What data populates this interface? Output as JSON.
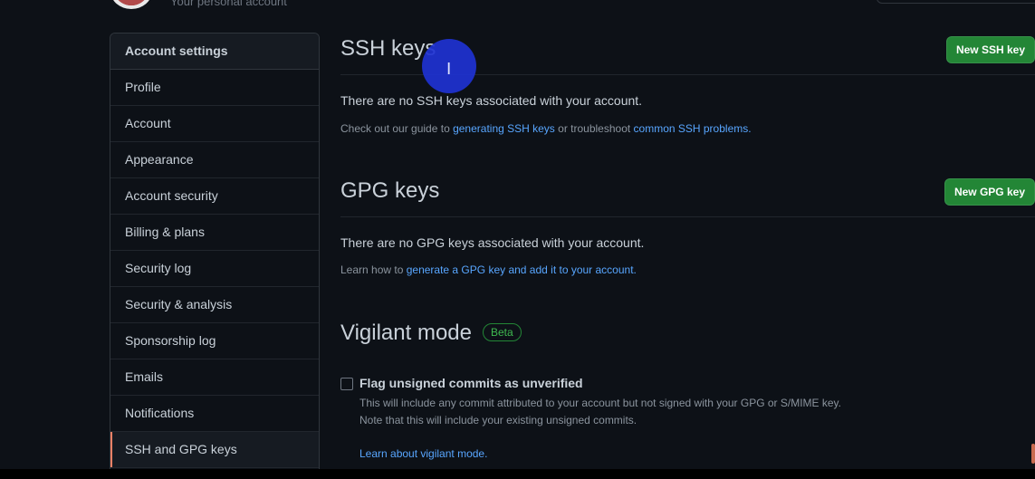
{
  "header": {
    "account_subtitle": "Your personal account"
  },
  "sidebar": {
    "title": "Account settings",
    "items": [
      {
        "label": "Profile"
      },
      {
        "label": "Account"
      },
      {
        "label": "Appearance"
      },
      {
        "label": "Account security"
      },
      {
        "label": "Billing & plans"
      },
      {
        "label": "Security log"
      },
      {
        "label": "Security & analysis"
      },
      {
        "label": "Sponsorship log"
      },
      {
        "label": "Emails"
      },
      {
        "label": "Notifications"
      },
      {
        "label": "SSH and GPG keys",
        "selected": true
      }
    ]
  },
  "ssh": {
    "title": "SSH keys",
    "button": "New SSH key",
    "empty_text": "There are no SSH keys associated with your account.",
    "help_prefix": "Check out our guide to ",
    "help_link1": "generating SSH keys",
    "help_middle": " or troubleshoot ",
    "help_link2": "common SSH problems."
  },
  "gpg": {
    "title": "GPG keys",
    "button": "New GPG key",
    "empty_text": "There are no GPG keys associated with your account.",
    "help_prefix": "Learn how to ",
    "help_link": "generate a GPG key and add it to your account."
  },
  "vigilant": {
    "title": "Vigilant mode",
    "badge": "Beta",
    "checkbox_label": "Flag unsigned commits as unverified",
    "desc1": "This will include any commit attributed to your account but not signed with your GPG or S/MIME key.",
    "desc2": "Note that this will include your existing unsigned commits.",
    "learn_link": "Learn about vigilant mode."
  },
  "colors": {
    "background": "#0d1117",
    "accent_green": "#238636",
    "link": "#58a6ff",
    "selected_marker": "#f78166",
    "cursor_halo": "#1e32d2"
  }
}
